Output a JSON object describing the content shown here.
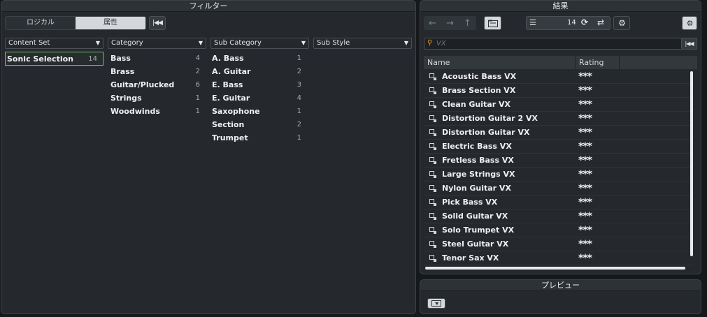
{
  "filter": {
    "title": "フィルター",
    "seg_logical": "ロジカル",
    "seg_attribute": "属性",
    "columns": [
      {
        "header": "Content Set",
        "items": [
          {
            "label": "Sonic Selection",
            "count": "14",
            "selected": true
          }
        ]
      },
      {
        "header": "Category",
        "items": [
          {
            "label": "Bass",
            "count": "4"
          },
          {
            "label": "Brass",
            "count": "2"
          },
          {
            "label": "Guitar/Plucked",
            "count": "6"
          },
          {
            "label": "Strings",
            "count": "1"
          },
          {
            "label": "Woodwinds",
            "count": "1"
          }
        ]
      },
      {
        "header": "Sub Category",
        "items": [
          {
            "label": "A. Bass",
            "count": "1"
          },
          {
            "label": "A. Guitar",
            "count": "2"
          },
          {
            "label": "E. Bass",
            "count": "3"
          },
          {
            "label": "E. Guitar",
            "count": "4"
          },
          {
            "label": "Saxophone",
            "count": "1"
          },
          {
            "label": "Section",
            "count": "2"
          },
          {
            "label": "Trumpet",
            "count": "1"
          }
        ]
      },
      {
        "header": "Sub Style",
        "items": []
      }
    ]
  },
  "results": {
    "title": "結果",
    "count": "14",
    "search_value": "VX",
    "col_name": "Name",
    "col_rating": "Rating",
    "rows": [
      {
        "name": "Acoustic Bass VX",
        "rating": "***"
      },
      {
        "name": "Brass Section VX",
        "rating": "***"
      },
      {
        "name": "Clean Guitar VX",
        "rating": "***"
      },
      {
        "name": "Distortion Guitar 2 VX",
        "rating": "***"
      },
      {
        "name": "Distortion Guitar VX",
        "rating": "***"
      },
      {
        "name": "Electric Bass VX",
        "rating": "***"
      },
      {
        "name": "Fretless Bass VX",
        "rating": "***"
      },
      {
        "name": "Large Strings VX",
        "rating": "***"
      },
      {
        "name": "Nylon Guitar VX",
        "rating": "***"
      },
      {
        "name": "Pick Bass VX",
        "rating": "***"
      },
      {
        "name": "Solid Guitar VX",
        "rating": "***"
      },
      {
        "name": "Solo Trumpet VX",
        "rating": "***"
      },
      {
        "name": "Steel Guitar VX",
        "rating": "***"
      },
      {
        "name": "Tenor Sax VX",
        "rating": "***"
      }
    ]
  },
  "preview": {
    "title": "プレビュー"
  },
  "colors": {
    "selection_border": "#6fcb5f",
    "search_icon": "#e59d2d",
    "panel_bg": "#25292d"
  },
  "icons": [
    "skip-back-icon",
    "back-arrow-icon",
    "forward-arrow-icon",
    "up-arrow-icon",
    "folder-icon",
    "list-icon",
    "sync-icon",
    "shuffle-icon",
    "gear-icon",
    "settings-panel-icon",
    "search-icon",
    "preset-icon",
    "preview-play-icon"
  ]
}
